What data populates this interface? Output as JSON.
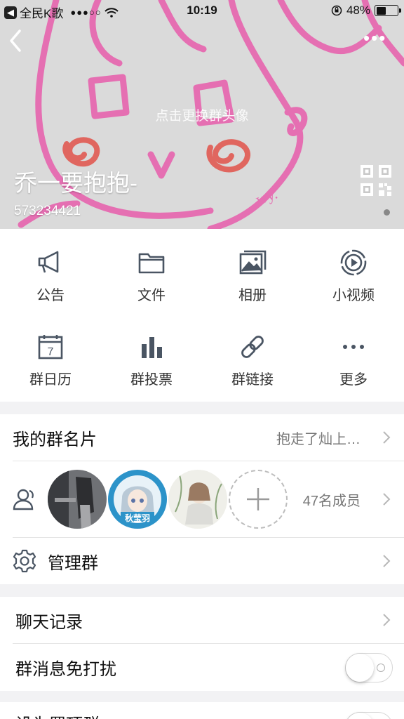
{
  "status_bar": {
    "back_app": "全民K歌",
    "time": "10:19",
    "battery": "48%",
    "battery_level": 0.48
  },
  "header": {
    "change_avatar": "点击更换群头像",
    "group_name": "乔一要抱抱-",
    "group_id": "573234421"
  },
  "features": [
    {
      "label": "公告",
      "icon": "megaphone-icon"
    },
    {
      "label": "文件",
      "icon": "folder-icon"
    },
    {
      "label": "相册",
      "icon": "album-icon"
    },
    {
      "label": "小视频",
      "icon": "video-icon"
    },
    {
      "label": "群日历",
      "icon": "calendar-icon"
    },
    {
      "label": "群投票",
      "icon": "vote-icon"
    },
    {
      "label": "群链接",
      "icon": "link-icon"
    },
    {
      "label": "更多",
      "icon": "more-icon"
    }
  ],
  "calendar_day": "7",
  "card": {
    "title": "我的群名片",
    "value": "抱走了灿上…"
  },
  "members": {
    "count": "47名成员",
    "avatar_badge": "秋莹羽"
  },
  "manage": {
    "title": "管理群"
  },
  "chat_history": {
    "title": "聊天记录"
  },
  "dnd": {
    "title": "群消息免打扰",
    "enabled": false
  },
  "pin": {
    "title": "设为置顶群"
  },
  "colors": {
    "accent": "#e56fb2",
    "icon": "#4a5563"
  }
}
